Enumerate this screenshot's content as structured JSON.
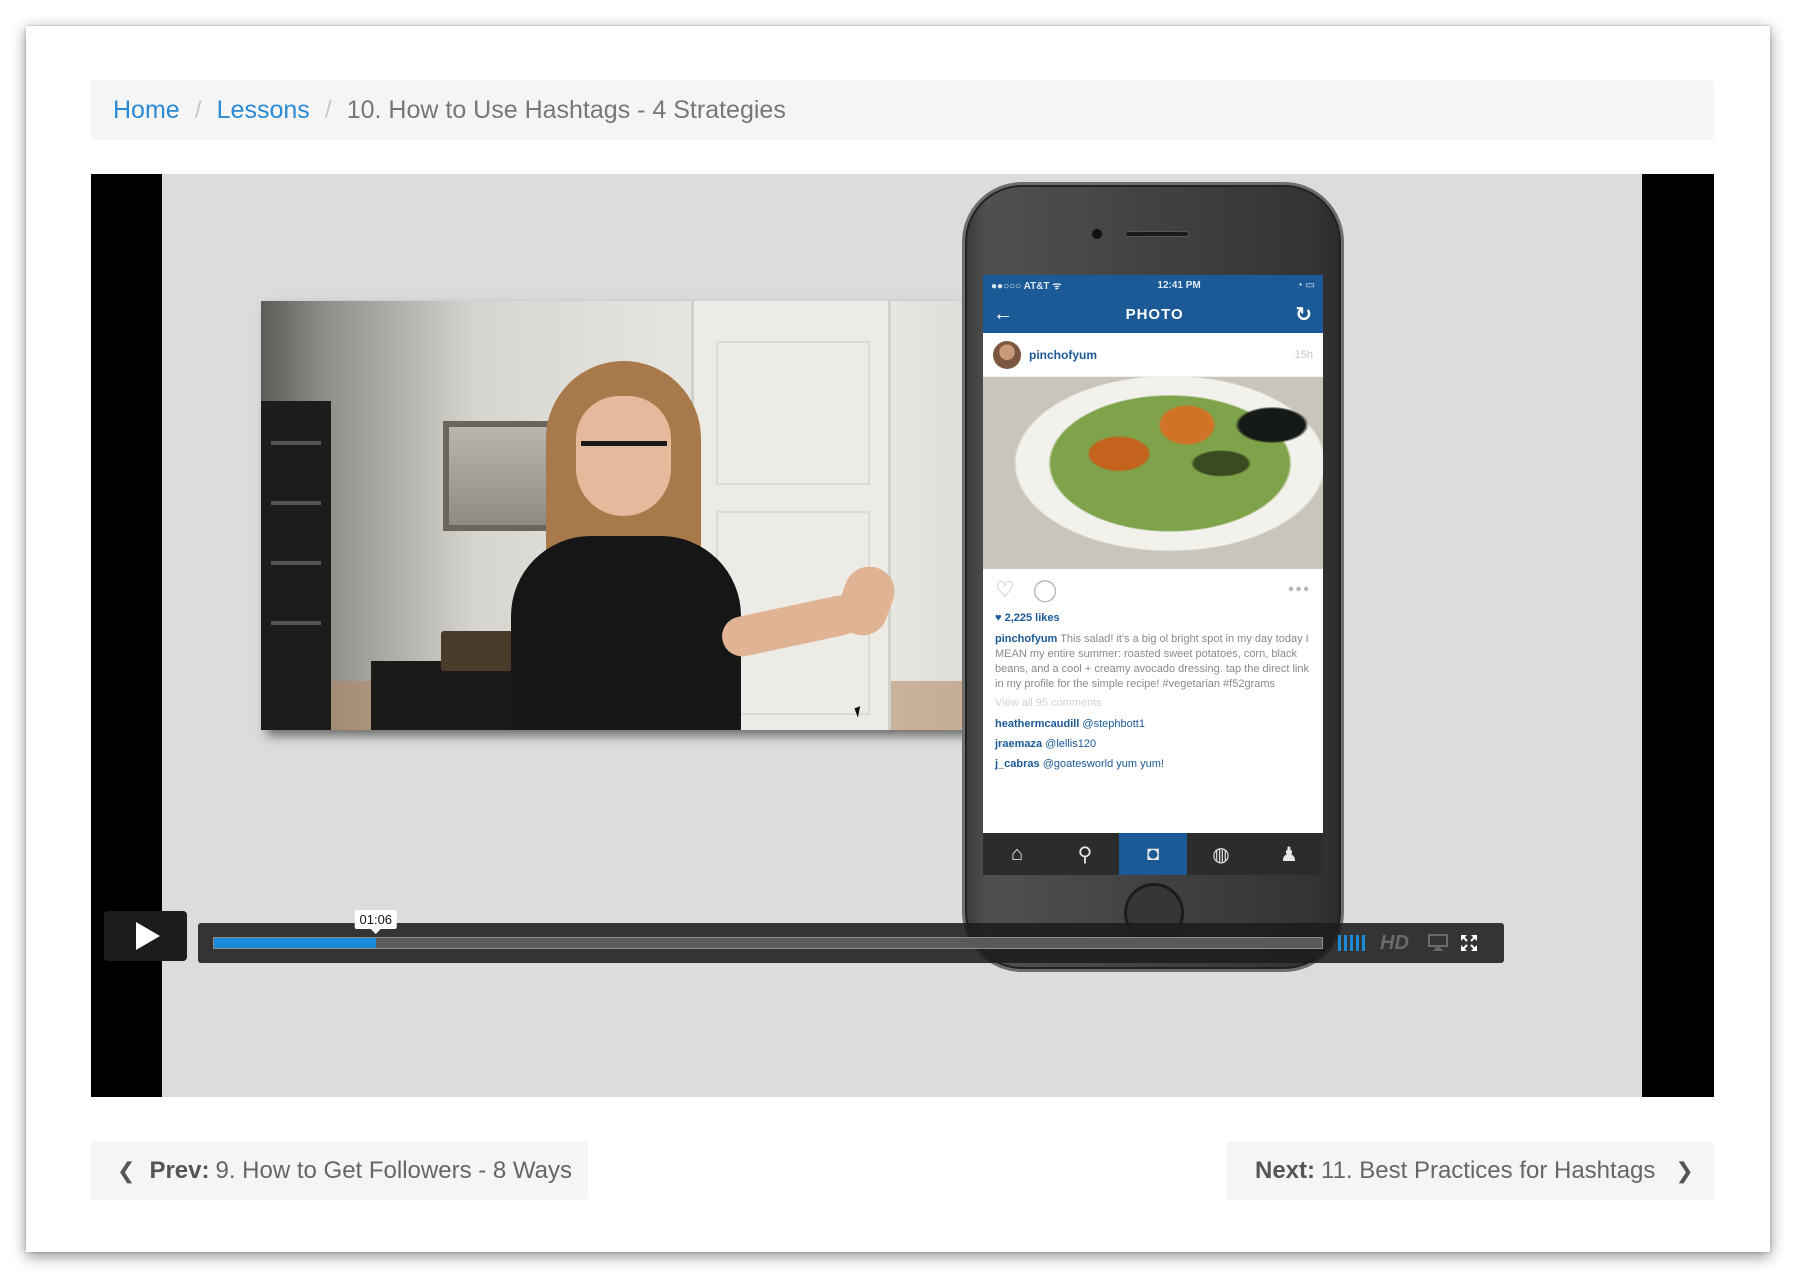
{
  "breadcrumb": {
    "home": "Home",
    "lessons": "Lessons",
    "current": "10. How to Use Hashtags - 4 Strategies",
    "separator": "/"
  },
  "video": {
    "current_time": "01:06",
    "progress": 0.146,
    "hd_label": "HD",
    "volume_level": 1.0,
    "phone": {
      "status_left": "●●○○○ AT&T ᯤ",
      "status_time": "12:41 PM",
      "status_right": "◔ ▭",
      "header_title": "PHOTO",
      "username": "pinchofyum",
      "post_age": "15h",
      "likes": "♥ 2,225 likes",
      "caption_user": "pinchofyum",
      "caption_text": "This salad! it's a big ol bright spot in my day today I MEAN my entire summer: roasted sweet potatoes, corn, black beans, and a cool + creamy avocado dressing. tap the direct link in my profile for the simple recipe! #vegetarian #f52grams",
      "view_all": "View all 95 comments",
      "comments": [
        {
          "user": "heathermcaudill",
          "text": "@stephbott1"
        },
        {
          "user": "jraemaza",
          "text": "@lellis120"
        },
        {
          "user": "j_cabras",
          "text": "@goatesworld yum yum!"
        }
      ]
    }
  },
  "nav": {
    "prev_label": "Prev:",
    "prev_title": "9. How to Get Followers - 8 Ways",
    "next_label": "Next:",
    "next_title": "11. Best Practices for Hashtags"
  },
  "colors": {
    "link": "#2a8ad4",
    "progress": "#1c8ad9",
    "instagram_blue": "#1b5a96"
  }
}
